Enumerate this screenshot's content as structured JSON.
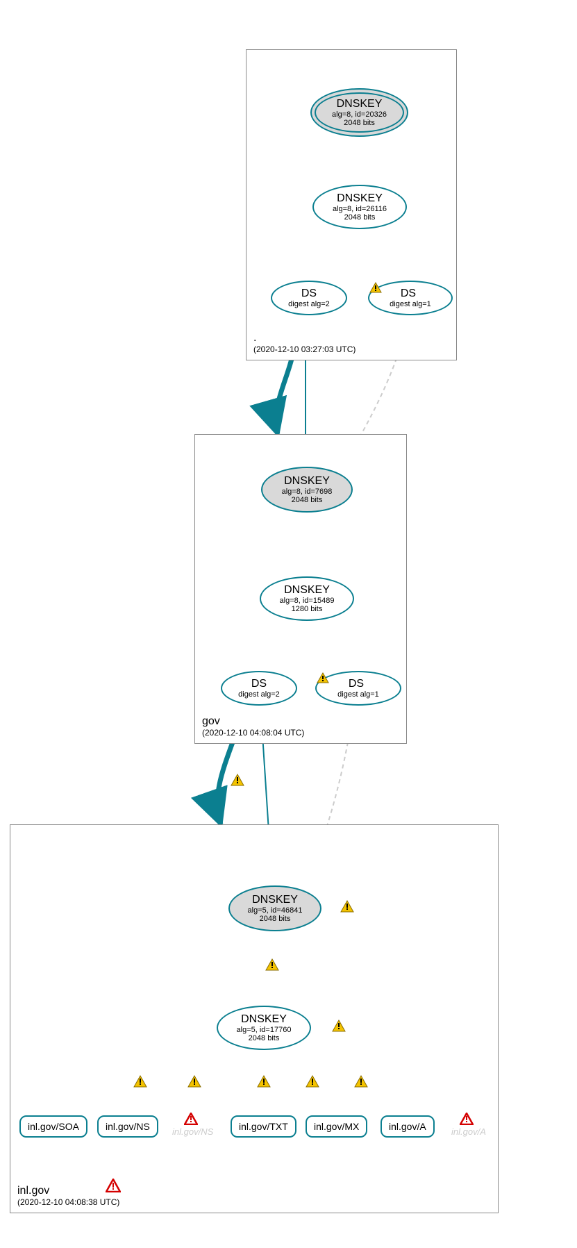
{
  "zones": {
    "root": {
      "name": ".",
      "timestamp": "(2020-12-10 03:27:03 UTC)"
    },
    "gov": {
      "name": "gov",
      "timestamp": "(2020-12-10 04:08:04 UTC)"
    },
    "inlgov": {
      "name": "inl.gov",
      "timestamp": "(2020-12-10 04:08:38 UTC)"
    }
  },
  "nodes": {
    "root_ksk": {
      "title": "DNSKEY",
      "line1": "alg=8, id=20326",
      "line2": "2048 bits"
    },
    "root_zsk": {
      "title": "DNSKEY",
      "line1": "alg=8, id=26116",
      "line2": "2048 bits"
    },
    "root_ds2": {
      "title": "DS",
      "line1": "digest alg=2"
    },
    "root_ds1": {
      "title": "DS",
      "line1": "digest alg=1"
    },
    "gov_ksk": {
      "title": "DNSKEY",
      "line1": "alg=8, id=7698",
      "line2": "2048 bits"
    },
    "gov_zsk": {
      "title": "DNSKEY",
      "line1": "alg=8, id=15489",
      "line2": "1280 bits"
    },
    "gov_ds2": {
      "title": "DS",
      "line1": "digest alg=2"
    },
    "gov_ds1": {
      "title": "DS",
      "line1": "digest alg=1"
    },
    "inl_ksk": {
      "title": "DNSKEY",
      "line1": "alg=5, id=46841",
      "line2": "2048 bits"
    },
    "inl_zsk": {
      "title": "DNSKEY",
      "line1": "alg=5, id=17760",
      "line2": "2048 bits"
    },
    "rr_soa": {
      "label": "inl.gov/SOA"
    },
    "rr_ns": {
      "label": "inl.gov/NS"
    },
    "rr_txt": {
      "label": "inl.gov/TXT"
    },
    "rr_mx": {
      "label": "inl.gov/MX"
    },
    "rr_a": {
      "label": "inl.gov/A"
    },
    "faded_ns": {
      "label": "inl.gov/NS"
    },
    "faded_a": {
      "label": "inl.gov/A"
    }
  },
  "colors": {
    "stroke": "#0b7f90",
    "dashed": "#cccccc",
    "warn": "#f4c300",
    "err": "#d40000"
  }
}
